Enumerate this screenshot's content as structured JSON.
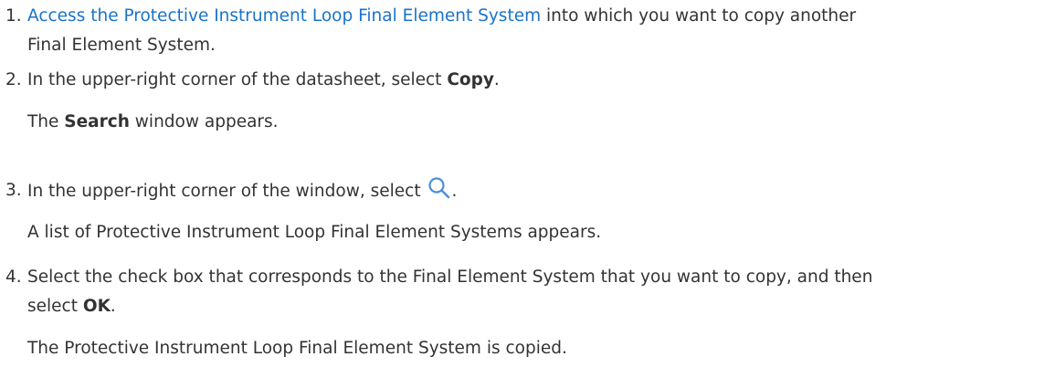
{
  "steps": [
    {
      "number": "1.",
      "link_text": "Access the Protective Instrument Loop Final Element System",
      "text_after_link": " into which you want to copy another",
      "line2": "Final Element System."
    },
    {
      "number": "2.",
      "text_before": "In the upper-right corner of the datasheet, select ",
      "bold": "Copy",
      "text_after": ".",
      "result_bold": "Search",
      "result_after": " window appears."
    },
    {
      "number": "3.",
      "text_before": "In the upper-right corner of the window, select ",
      "icon": "search-icon",
      "text_after": ".",
      "result": "A list of Protective Instrument Loop Final Element Systems appears."
    },
    {
      "number": "4.",
      "text_line1": "Select the check box that corresponds to the Final Element System that you want to copy, and then",
      "text_before_bold": "select ",
      "bold": "OK",
      "text_after": ".",
      "result": "The Protective Instrument Loop Final Element System is copied."
    }
  ],
  "colors": {
    "text": "#333333",
    "link": "#1a73c9",
    "icon": "#4a90d9"
  }
}
